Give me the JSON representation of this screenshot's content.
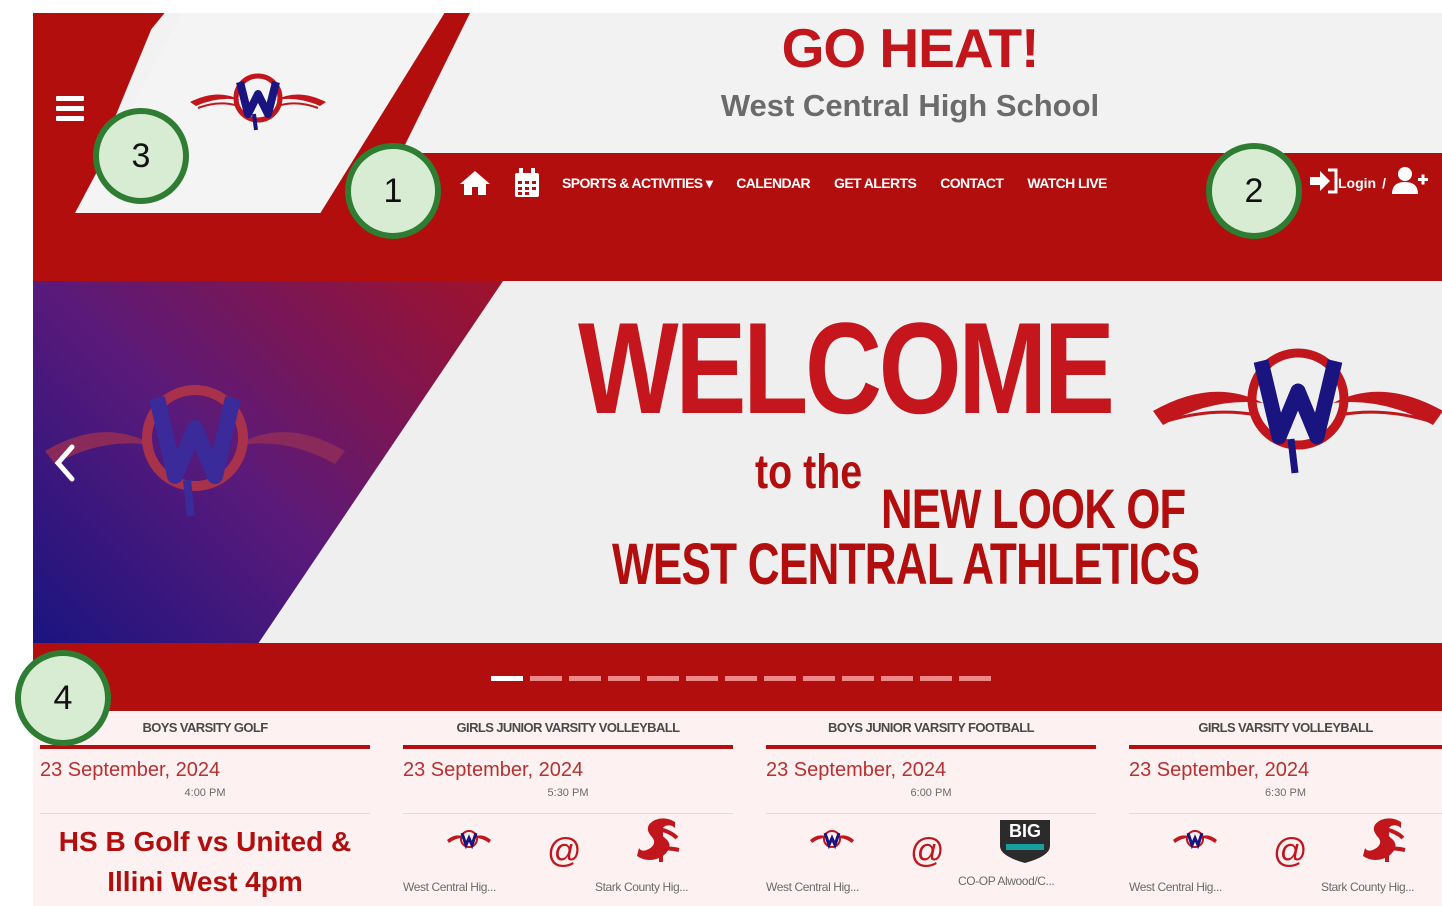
{
  "header": {
    "title": "GO HEAT!",
    "subtitle": "West Central High School"
  },
  "nav": {
    "items": [
      "SPORTS & ACTIVITIES ▾",
      "CALENDAR",
      "GET ALERTS",
      "CONTACT",
      "WATCH LIVE"
    ],
    "icons": [
      "home-icon",
      "calendar-icon"
    ]
  },
  "auth": {
    "login": "Login",
    "separator": "/"
  },
  "hero": {
    "line1": "WELCOME",
    "line2": "to the",
    "line3": "NEW LOOK OF",
    "line4": "WEST CENTRAL ATHLETICS",
    "slide_count": 13,
    "active_slide": 1
  },
  "callouts": [
    "1",
    "2",
    "3",
    "4"
  ],
  "events": [
    {
      "category": "BOYS VARSITY GOLF",
      "date": "23 September, 2024",
      "time": "4:00 PM",
      "title": "HS B Golf vs United & Illini West 4pm"
    },
    {
      "category": "GIRLS JUNIOR VARSITY VOLLEYBALL",
      "date": "23 September, 2024",
      "time": "5:30 PM",
      "home": "West Central Hig...",
      "at": "@",
      "away": "Stark County Hig..."
    },
    {
      "category": "BOYS JUNIOR VARSITY FOOTBALL",
      "date": "23 September, 2024",
      "time": "6:00 PM",
      "home": "West Central Hig...",
      "at": "@",
      "away": "CO-OP Alwood/C...",
      "away_badge": "BIG"
    },
    {
      "category": "GIRLS VARSITY VOLLEYBALL",
      "date": "23 September, 2024",
      "time": "6:30 PM",
      "home": "West Central Hig...",
      "at": "@",
      "away": "Stark County Hig..."
    }
  ],
  "colors": {
    "brand_red": "#b20e0e",
    "title_red": "#c0161c",
    "navy": "#1a1480",
    "callout_green": "#2e7d32"
  }
}
